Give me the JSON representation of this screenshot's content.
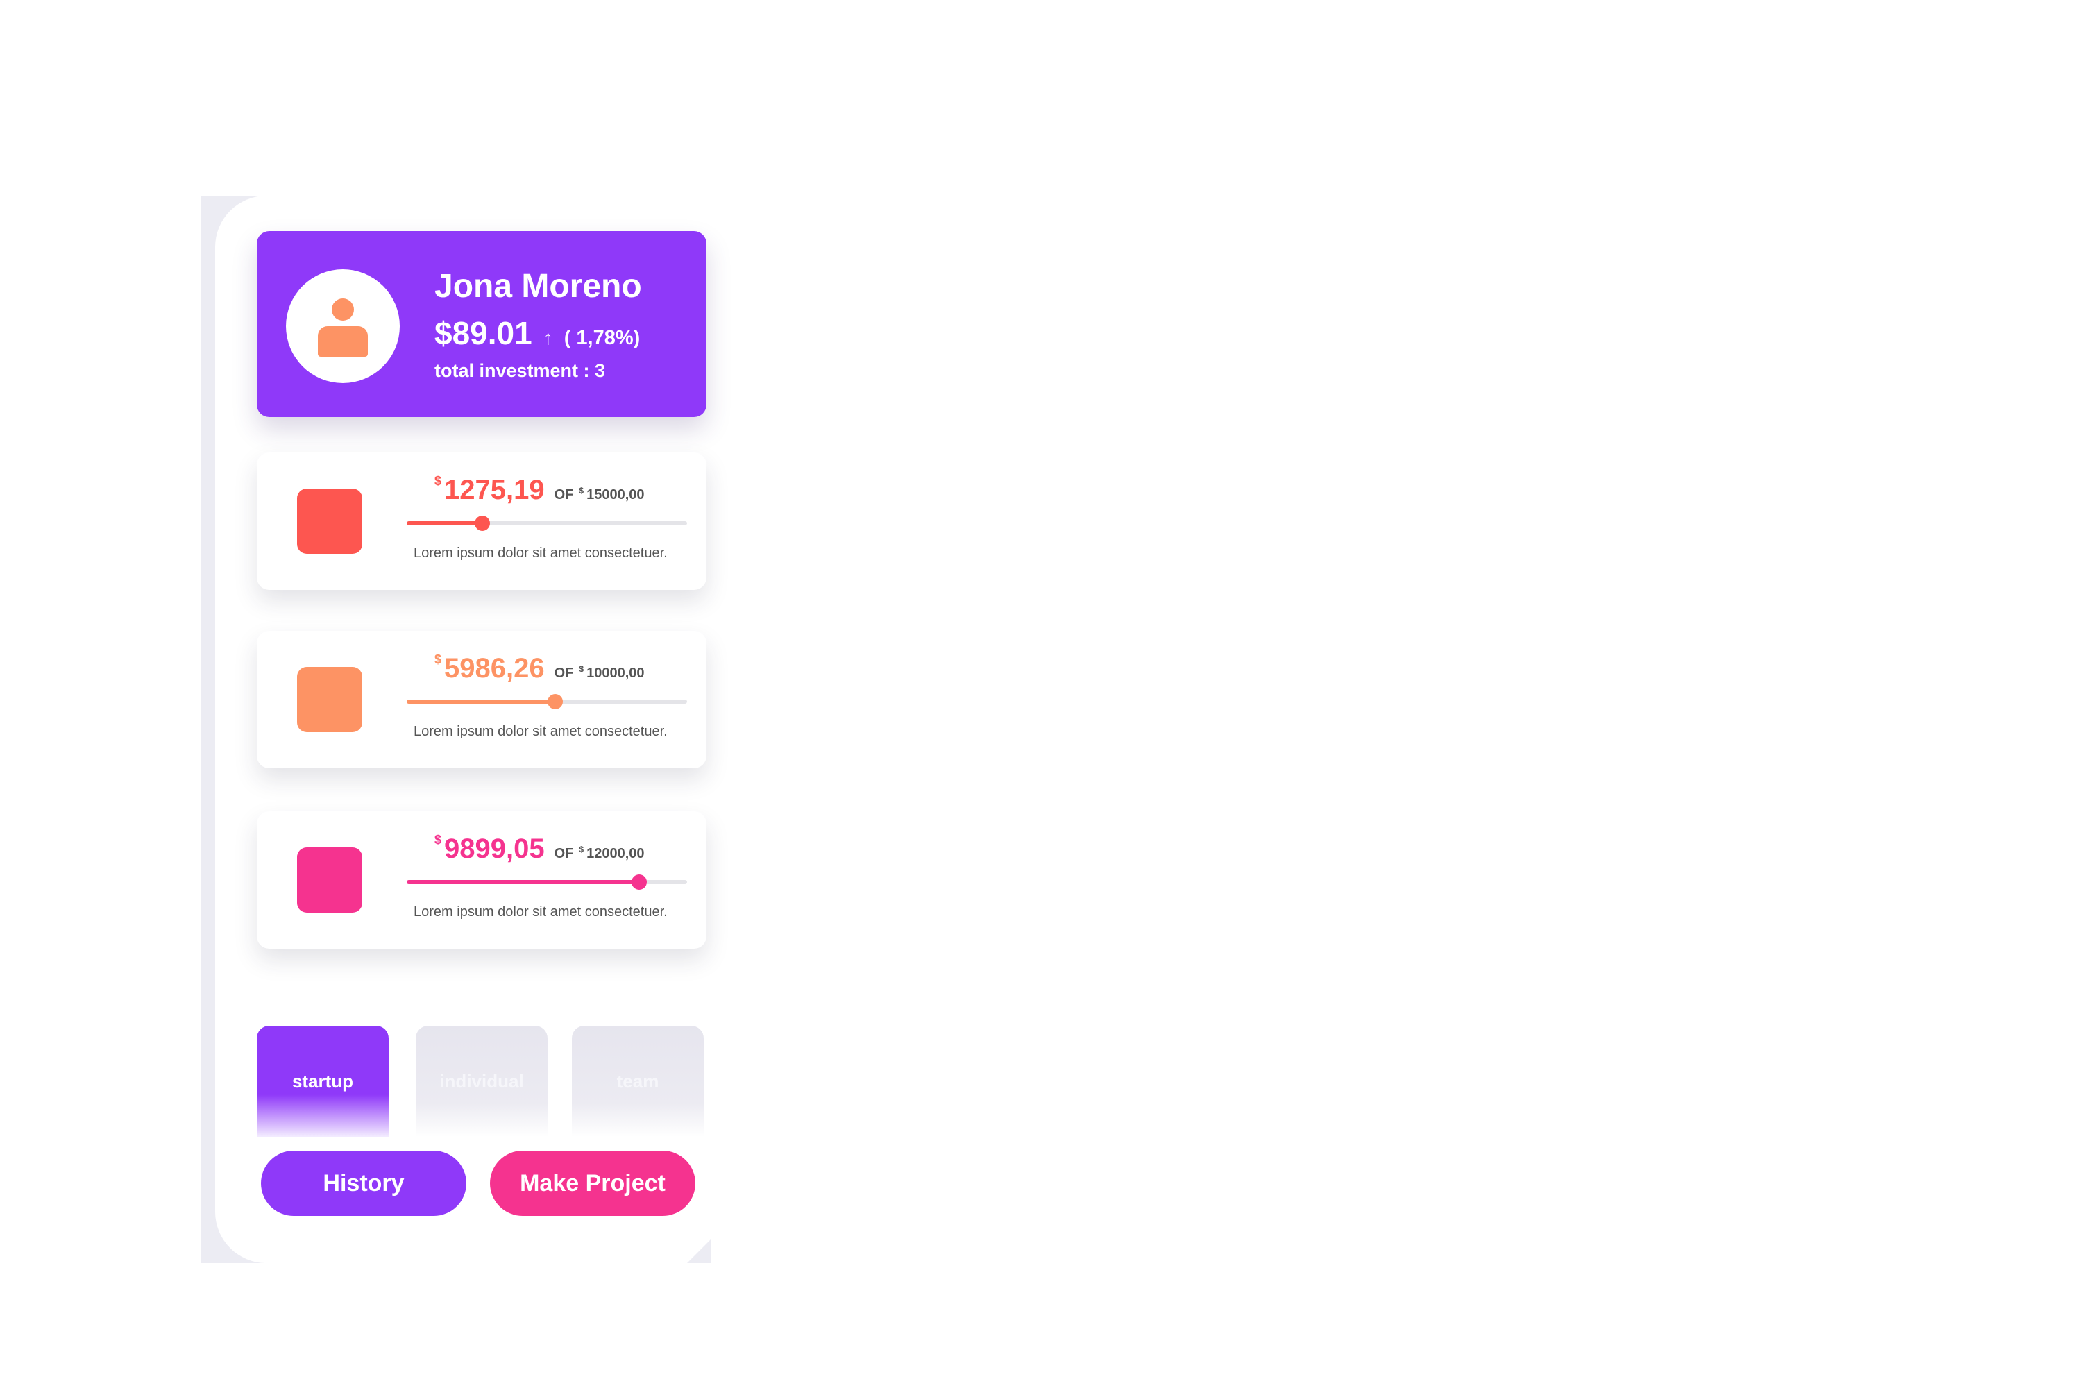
{
  "colors": {
    "purple": "#8f39f9",
    "red": "#fd5650",
    "orange": "#fd9364",
    "pink": "#f5338f",
    "frame": "#ececf3"
  },
  "profile": {
    "avatar_icon": "user-icon",
    "name": "Jona Moreno",
    "balance": "$89.01",
    "trend_icon": "arrow-up-icon",
    "trend_arrow": "↑",
    "change": "( 1,78%)",
    "investments": "total investment : 3"
  },
  "cards": [
    {
      "currency": "$",
      "amount": "1275,19",
      "of_label": "OF",
      "target_currency": "$",
      "target": "15000,00",
      "progress": 0.27,
      "description": "Lorem ipsum dolor sit amet consectetuer.",
      "color": "#fd5650"
    },
    {
      "currency": "$",
      "amount": "5986,26",
      "of_label": "OF",
      "target_currency": "$",
      "target": "10000,00",
      "progress": 0.53,
      "description": "Lorem ipsum dolor sit amet consectetuer.",
      "color": "#fd9364"
    },
    {
      "currency": "$",
      "amount": "9899,05",
      "of_label": "OF",
      "target_currency": "$",
      "target": "12000,00",
      "progress": 0.83,
      "description": "Lorem ipsum dolor sit amet consectetuer.",
      "color": "#f5338f"
    }
  ],
  "tabs": [
    {
      "label": "startup",
      "active": true
    },
    {
      "label": "individual",
      "active": false
    },
    {
      "label": "team",
      "active": false
    }
  ],
  "buttons": {
    "history": "History",
    "make_project": "Make Project"
  }
}
